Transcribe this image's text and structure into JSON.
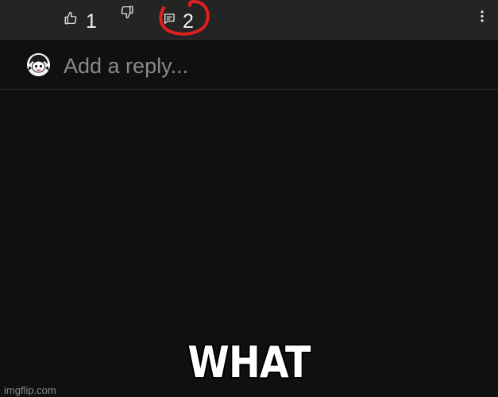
{
  "actions": {
    "like_count": "1",
    "reply_count": "2",
    "icons": {
      "like": "thumb-up-icon",
      "dislike": "thumb-down-icon",
      "reply": "reply-comment-icon",
      "more": "more-vertical-icon"
    }
  },
  "reply_box": {
    "placeholder": "Add a reply..."
  },
  "overlay": {
    "caption": "WHAT",
    "watermark": "imgflip.com",
    "annotation_color": "#e0201c"
  },
  "colors": {
    "background": "#101010",
    "action_bar": "#242424"
  }
}
